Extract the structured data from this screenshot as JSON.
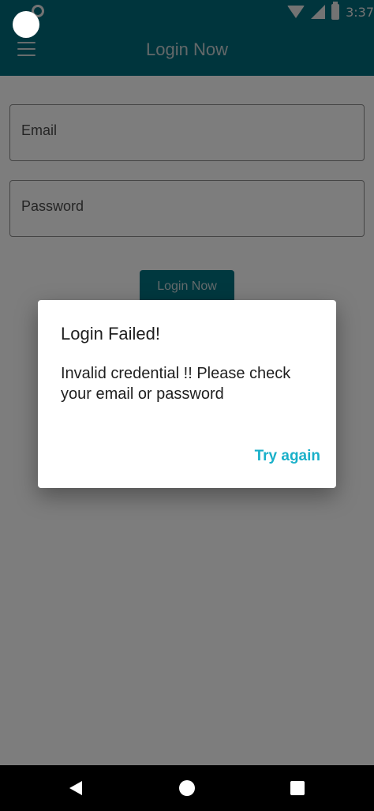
{
  "status_bar": {
    "time": "3:37",
    "icons": [
      "wifi-icon",
      "signal-icon",
      "battery-icon"
    ]
  },
  "app_bar": {
    "title": "Login Now",
    "menu_icon": "menu-icon"
  },
  "form": {
    "email_placeholder": "Email",
    "password_placeholder": "Password",
    "login_label": "Login Now"
  },
  "dialog": {
    "title": "Login Failed!",
    "message": "Invalid credential !! Please check your email or password",
    "action_label": "Try again"
  },
  "colors": {
    "primary": "#006a7a",
    "accent": "#19b0c9"
  }
}
